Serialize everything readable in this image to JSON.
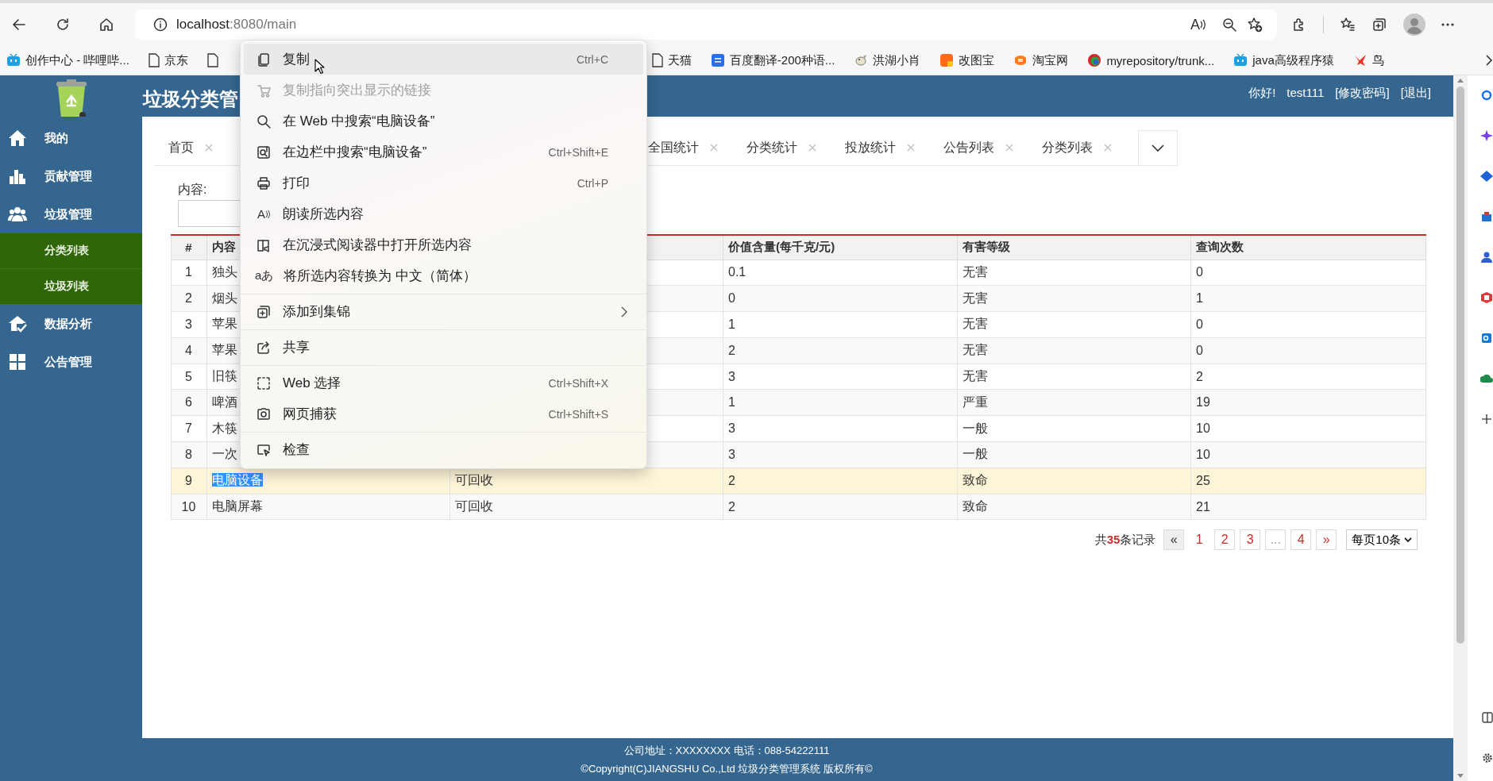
{
  "browser": {
    "address_host": "localhost",
    "address_path": ":8080/main",
    "read_aloud_glyph": "A"
  },
  "bookmarks": [
    {
      "kind": "bili",
      "label": "创作中心 - 哔哩哔..."
    },
    {
      "kind": "page",
      "label": "京东"
    },
    {
      "kind": "page"
    },
    {
      "kind": "page",
      "label": "天猫"
    },
    {
      "kind": "translate",
      "label": "百度翻译-200种语..."
    },
    {
      "kind": "mascot",
      "label": "洪湖小肖"
    },
    {
      "kind": "orange",
      "label": "改图宝"
    },
    {
      "kind": "taobao",
      "label": "淘宝网"
    },
    {
      "kind": "repo",
      "label": "myrepository/trunk..."
    },
    {
      "kind": "bili",
      "label": "java高级程序猿"
    },
    {
      "kind": "bird",
      "label": "鸟"
    }
  ],
  "header": {
    "title": "垃圾分类管",
    "greeting": "你好!",
    "user": "test111",
    "links": [
      "[修改密码]",
      "[退出]"
    ]
  },
  "sidebar": {
    "items": [
      {
        "kind": "home",
        "label": "我的"
      },
      {
        "kind": "chart",
        "label": "贡献管理"
      },
      {
        "kind": "people",
        "label": "垃圾管理",
        "expanded": true,
        "children": [
          {
            "label": "分类列表"
          },
          {
            "label": "垃圾列表"
          }
        ]
      },
      {
        "kind": "analysis",
        "label": "数据分析"
      },
      {
        "kind": "grid",
        "label": "公告管理"
      }
    ]
  },
  "tabs": [
    {
      "label": "首页"
    },
    {
      "label": "全国统计"
    },
    {
      "label": "分类统计"
    },
    {
      "label": "投放统计"
    },
    {
      "label": "公告列表"
    },
    {
      "label": "分类列表"
    }
  ],
  "filter": {
    "label": "内容:"
  },
  "table": {
    "columns": {
      "no": "#",
      "content": "内容",
      "value": "价值含量(每千克/元)",
      "hazard": "有害等级",
      "queries": "查询次数"
    },
    "rows": [
      {
        "no": "1",
        "content": "独头",
        "value": "0.1",
        "hazard": "无害",
        "queries": "0",
        "selected": false,
        "text_selected": false
      },
      {
        "no": "2",
        "content": "烟头",
        "value": "0",
        "hazard": "无害",
        "queries": "1",
        "selected": false,
        "text_selected": false
      },
      {
        "no": "3",
        "content": "苹果",
        "value": "1",
        "hazard": "无害",
        "queries": "0",
        "selected": false,
        "text_selected": false
      },
      {
        "no": "4",
        "content": "苹果",
        "value": "2",
        "hazard": "无害",
        "queries": "0",
        "selected": false,
        "text_selected": false
      },
      {
        "no": "5",
        "content": "旧筷",
        "value": "3",
        "hazard": "无害",
        "queries": "2",
        "selected": false,
        "text_selected": false
      },
      {
        "no": "6",
        "content": "啤酒",
        "value": "1",
        "hazard": "严重",
        "queries": "19",
        "selected": false,
        "text_selected": false
      },
      {
        "no": "7",
        "content": "木筷",
        "value": "3",
        "hazard": "一般",
        "queries": "10",
        "selected": false,
        "text_selected": false
      },
      {
        "no": "8",
        "content": "一次",
        "value": "3",
        "hazard": "一般",
        "queries": "10",
        "selected": false,
        "text_selected": false
      },
      {
        "no": "9",
        "content": "电脑设备",
        "column_3": "可回收",
        "value": "2",
        "hazard": "致命",
        "queries": "25",
        "selected": true,
        "text_selected": true
      },
      {
        "no": "10",
        "content": "电脑屏幕",
        "column_3": "可回收",
        "value": "2",
        "hazard": "致命",
        "queries": "21",
        "selected": false,
        "text_selected": false
      }
    ]
  },
  "pagination": {
    "summary": "共**35**条记录",
    "prev": "«",
    "next": "»",
    "page_size": "每页10条",
    "pages": [
      {
        "kind": "page",
        "label": "1",
        "selected": true
      },
      {
        "kind": "page",
        "label": "2",
        "selected": false
      },
      {
        "kind": "page",
        "label": "3",
        "selected": false
      },
      {
        "kind": "ellipsis",
        "label": "...",
        "selected": false
      },
      {
        "kind": "page",
        "label": "4",
        "selected": false
      }
    ]
  },
  "footer": {
    "lines": [
      "公司地址：XXXXXXXX 电话：088-54222111",
      "©Copyright(C)JIANGSHU Co.,Ltd 垃圾分类管理系统 版权所有©"
    ]
  },
  "context_menu": {
    "groups": [
      [
        {
          "kind": "copy",
          "label": "复制",
          "shortcut": "Ctrl+C",
          "selected": true,
          "disabled": false,
          "submenu": false
        },
        {
          "kind": "link",
          "label": "复制指向突出显示的链接",
          "selected": false,
          "disabled": true,
          "submenu": false
        },
        {
          "kind": "search",
          "label": "在 Web 中搜索“电脑设备”",
          "selected": false,
          "disabled": false,
          "submenu": false
        },
        {
          "kind": "sidebar-search",
          "label": "在边栏中搜索“电脑设备”",
          "shortcut": "Ctrl+Shift+E",
          "selected": false,
          "disabled": false,
          "submenu": false
        },
        {
          "kind": "print",
          "label": "打印",
          "shortcut": "Ctrl+P",
          "selected": false,
          "disabled": false,
          "submenu": false
        },
        {
          "kind": "read",
          "icon_text": "A",
          "label": "朗读所选内容",
          "selected": false,
          "disabled": false,
          "submenu": false
        },
        {
          "kind": "reader",
          "label": "在沉浸式阅读器中打开所选内容",
          "selected": false,
          "disabled": false,
          "submenu": false
        },
        {
          "kind": "translate",
          "icon_text": "aあ",
          "label": "将所选内容转换为 中文（简体）",
          "selected": false,
          "disabled": false,
          "submenu": false
        }
      ],
      [
        {
          "kind": "collections",
          "label": "添加到集锦",
          "selected": false,
          "disabled": false,
          "submenu": true
        }
      ],
      [
        {
          "kind": "share",
          "label": "共享",
          "selected": false,
          "disabled": false,
          "submenu": false
        }
      ],
      [
        {
          "kind": "select",
          "label": "Web 选择",
          "shortcut": "Ctrl+Shift+X",
          "selected": false,
          "disabled": false,
          "submenu": false
        },
        {
          "kind": "capture",
          "label": "网页捕获",
          "shortcut": "Ctrl+Shift+S",
          "selected": false,
          "disabled": false,
          "submenu": false
        }
      ],
      [
        {
          "kind": "inspect",
          "label": "检查",
          "selected": false,
          "disabled": false,
          "submenu": false
        }
      ]
    ]
  }
}
